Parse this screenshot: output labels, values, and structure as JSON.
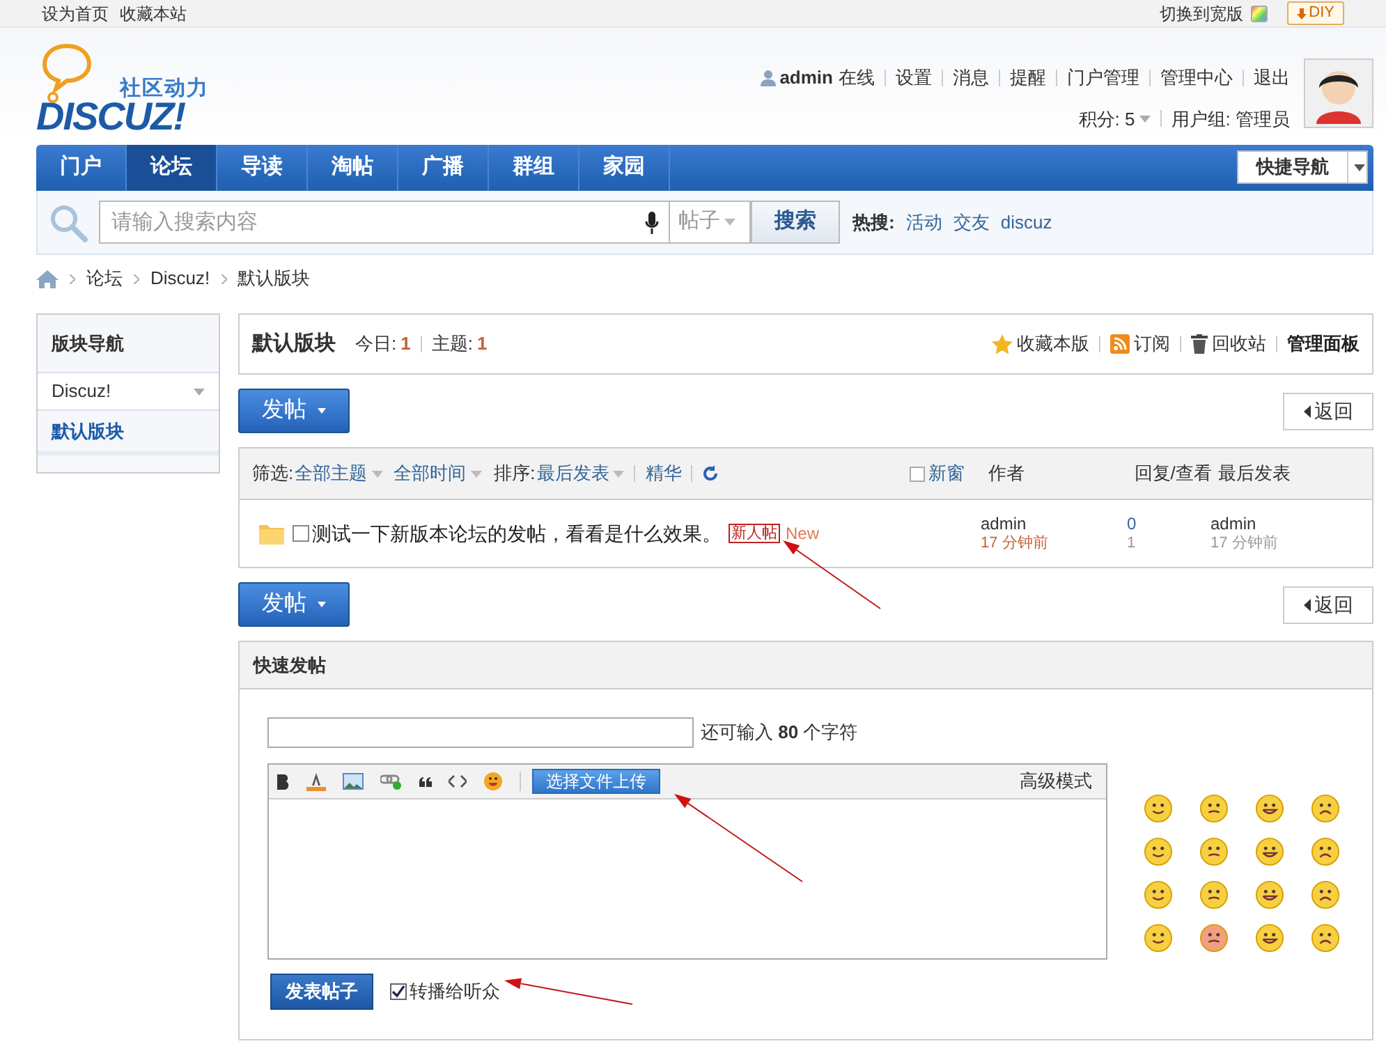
{
  "topbar": {
    "links": [
      "设为首页",
      "收藏本站"
    ],
    "switch_text": "切换到宽版",
    "diy_button": "DIY"
  },
  "logo": {
    "tagline": "社区动力",
    "wordmark": "DISCUZ!"
  },
  "user": {
    "name": "admin",
    "status": "在线",
    "links": [
      "设置",
      "消息",
      "提醒",
      "门户管理",
      "管理中心",
      "退出"
    ],
    "points": "积分: 5",
    "group": "用户组: 管理员"
  },
  "nav": {
    "items": [
      {
        "label": "门户",
        "selected": false
      },
      {
        "label": "论坛",
        "selected": true
      },
      {
        "label": "导读",
        "selected": false
      },
      {
        "label": "淘帖",
        "selected": false
      },
      {
        "label": "广播",
        "selected": false
      },
      {
        "label": "群组",
        "selected": false
      },
      {
        "label": "家园",
        "selected": false
      }
    ],
    "quick_nav": "快捷导航"
  },
  "search": {
    "placeholder": "请输入搜索内容",
    "type": "帖子",
    "button": "搜索",
    "hot_label": "热搜:",
    "hot": [
      "活动",
      "交友",
      "discuz"
    ]
  },
  "breadcrumb": [
    "论坛",
    "Discuz!",
    "默认版块"
  ],
  "sidebar": {
    "title": "版块导航",
    "items": [
      {
        "label": "Discuz!",
        "kind": "group",
        "selected": false
      },
      {
        "label": "默认版块",
        "kind": "forum",
        "selected": true
      }
    ]
  },
  "forum": {
    "name": "默认版块",
    "today_label": "今日:",
    "today": "1",
    "topics_label": "主题:",
    "topics": "1",
    "actions": [
      {
        "label": "收藏本版",
        "kind": "star"
      },
      {
        "label": "订阅",
        "kind": "rss"
      },
      {
        "label": "回收站",
        "kind": "trash"
      },
      {
        "label": "管理面板",
        "kind": "plain"
      }
    ]
  },
  "post_button": "发帖",
  "back_button": "返回",
  "filter": {
    "label": "筛选:",
    "options": [
      "全部主题",
      "全部时间"
    ],
    "sort_label": "排序:",
    "sort": "最后发表",
    "digest": "精华",
    "new_window": {
      "label": "新窗",
      "checked": false
    },
    "columns": [
      "作者",
      "回复/查看",
      "最后发表"
    ]
  },
  "threads": [
    {
      "title": "测试一下新版本论坛的发帖，看看是什么效果。",
      "checked": false,
      "tag": "新人帖",
      "new": "New",
      "author": "admin",
      "author_time": "17 分钟前",
      "replies": "0",
      "views": "1",
      "last_user": "admin",
      "last_time": "17 分钟前"
    }
  ],
  "post_button_2": "发帖",
  "back_button_2": "返回",
  "quick_post": {
    "title": "快速发帖",
    "hint": "还可输入 **80** 个字符",
    "upload_button": "选择文件上传",
    "mode": "高级模式",
    "submit": "发表帖子",
    "broadcast": {
      "label": "转播给听众",
      "checked": true
    }
  }
}
